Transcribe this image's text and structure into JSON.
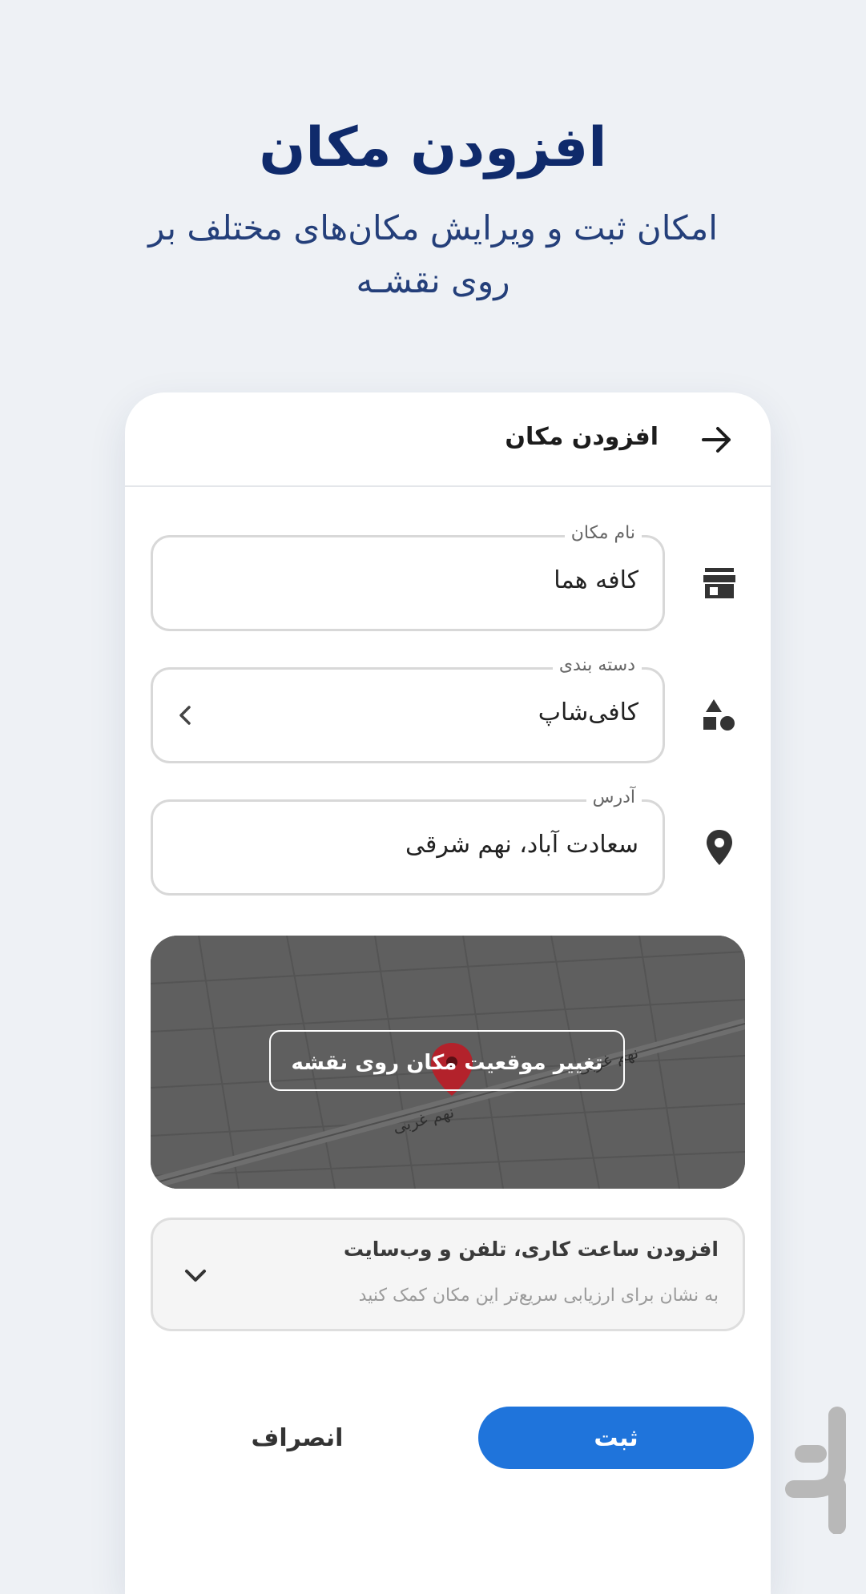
{
  "promo": {
    "headline": "افزودن مکان",
    "subline": "امکان ثبت و ویرایش مکان‌های مختلف بر روی نقشـه"
  },
  "appbar": {
    "title": "افزودن مکان",
    "back_icon": "arrow-right-icon"
  },
  "form": {
    "name": {
      "label": "نام مکان",
      "value": "کافه هما",
      "icon": "store-icon"
    },
    "category": {
      "label": "دسته بندی",
      "value": "کافی‌شاپ",
      "icon": "shapes-icon"
    },
    "address": {
      "label": "آدرس",
      "value": "سعادت آباد، نهم شرقی",
      "icon": "location-pin-icon"
    }
  },
  "map": {
    "button_label": "تغییر موقعیت مکان روی نقشه",
    "street_label_1": "نهم غربی",
    "street_label_2": "نهم غربی",
    "pin_color": "#b3222b"
  },
  "extras": {
    "title": "افزودن ساعت کاری، تلفن و وب‌سایت",
    "subtitle": "به نشان برای ارزیابی سریع‌تر این مکان کمک کنید"
  },
  "actions": {
    "submit_label": "ثبت",
    "cancel_label": "انصراف"
  },
  "colors": {
    "accent": "#1f74db",
    "headline": "#0f2a6b",
    "background": "#eef1f5"
  }
}
